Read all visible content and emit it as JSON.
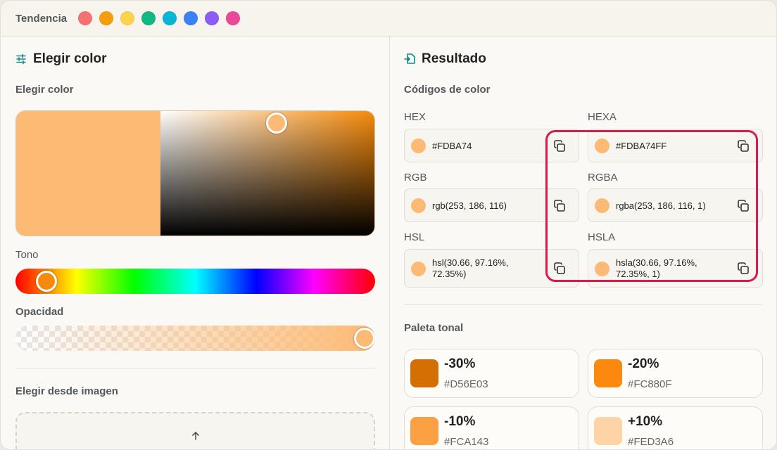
{
  "topbar": {
    "label": "Tendencia",
    "swatches": [
      {
        "name": "red",
        "color": "#F87171"
      },
      {
        "name": "orange",
        "color": "#F59E0B"
      },
      {
        "name": "yellow",
        "color": "#FCD34D"
      },
      {
        "name": "green",
        "color": "#10B981"
      },
      {
        "name": "cyan",
        "color": "#06B6D4"
      },
      {
        "name": "blue",
        "color": "#3B82F6"
      },
      {
        "name": "violet",
        "color": "#8B5CF6"
      },
      {
        "name": "pink",
        "color": "#EC4899"
      }
    ]
  },
  "left": {
    "title": "Elegir color",
    "title_icon": "sliders-icon",
    "picker_label": "Elegir color",
    "hue_label": "Tono",
    "opacity_label": "Opacidad",
    "image_label": "Elegir desde imagen",
    "upload_icon": "upload-icon",
    "current_color": "#FDBA74",
    "accent": "#0e8a8a"
  },
  "right": {
    "title": "Resultado",
    "title_icon": "export-icon",
    "codes_label": "Códigos de color",
    "codes": [
      {
        "key": "hex",
        "label": "HEX",
        "value": "#FDBA74"
      },
      {
        "key": "hexa",
        "label": "HEXA",
        "value": "#FDBA74FF"
      },
      {
        "key": "rgb",
        "label": "RGB",
        "value": "rgb(253, 186, 116)"
      },
      {
        "key": "rgba",
        "label": "RGBA",
        "value": "rgba(253, 186, 116, 1)"
      },
      {
        "key": "hsl",
        "label": "HSL",
        "value_line1": "hsl(30.66, 97.16%,",
        "value_line2": "72.35%)"
      },
      {
        "key": "hsla",
        "label": "HSLA",
        "value_line1": "hsla(30.66, 97.16%,",
        "value_line2": "72.35%, 1)"
      }
    ],
    "highlight_color": "#D81B4F",
    "palette_label": "Paleta tonal",
    "palette": [
      {
        "pct": "-30%",
        "hex": "#D56E03",
        "color": "#D56E03"
      },
      {
        "pct": "-20%",
        "hex": "#FC880F",
        "color": "#FC880F"
      },
      {
        "pct": "-10%",
        "hex": "#FCA143",
        "color": "#FCA143"
      },
      {
        "pct": "+10%",
        "hex": "#FED3A6",
        "color": "#FED3A6"
      }
    ]
  }
}
